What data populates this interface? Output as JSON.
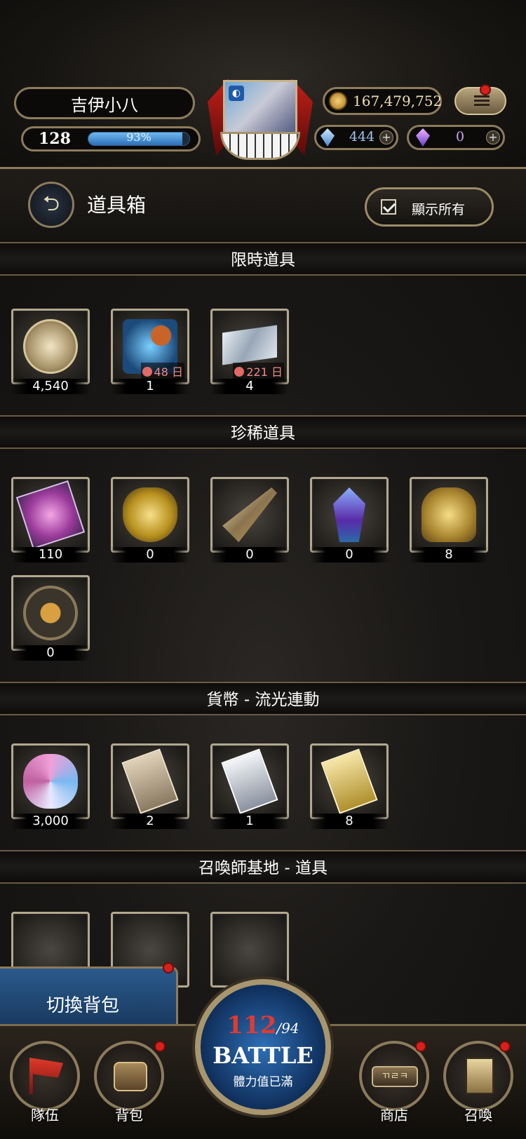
{
  "player": {
    "name": "吉伊小八",
    "level": "128",
    "exp_percent_label": "93%",
    "exp_fraction": 0.93,
    "gold": "167,479,752",
    "blue_crystals": "444",
    "purple_crystals": "0"
  },
  "header": {
    "title": "道具箱",
    "show_all_label": "顯示所有",
    "back_icon": "back-arrow-icon"
  },
  "sections": [
    {
      "title": "限時道具",
      "items": [
        {
          "name": "coin-medal",
          "count": "4,540",
          "timer": ""
        },
        {
          "name": "summon-ticket",
          "count": "1",
          "timer": "48 日"
        },
        {
          "name": "silver-ticket",
          "count": "4",
          "timer": "221 日"
        }
      ]
    },
    {
      "title": "珍稀道具",
      "items": [
        {
          "name": "pink-scroll",
          "count": "110"
        },
        {
          "name": "golden-heart",
          "count": "0"
        },
        {
          "name": "golden-horn",
          "count": "0"
        },
        {
          "name": "blue-crystal",
          "count": "0"
        },
        {
          "name": "leaf-sack",
          "count": "8"
        },
        {
          "name": "astrolabe",
          "count": "0"
        }
      ]
    },
    {
      "title": "貨幣 - 流光連動",
      "items": [
        {
          "name": "prism-gem",
          "count": "3,000"
        },
        {
          "name": "bronze-card",
          "count": "2"
        },
        {
          "name": "silver-card",
          "count": "1"
        },
        {
          "name": "gold-card",
          "count": "8"
        }
      ]
    },
    {
      "title": "召喚師基地 - 道具",
      "items": []
    }
  ],
  "switch_bag_label": "切換背包",
  "nav": {
    "team": "隊伍",
    "bag": "背包",
    "shop": "商店",
    "summon": "召喚",
    "shop_sign": "ㄲㄹㅋ"
  },
  "battle": {
    "stamina_current": "112",
    "stamina_max": "/94",
    "title": "BATTLE",
    "status": "體力值已滿"
  },
  "colors": {
    "accent_gold": "#8c7b5c",
    "battle_blue": "#2e6fb6",
    "stamina_red": "#e23a30",
    "timer_pink": "#ef8a86",
    "notify_red": "#d8201c"
  }
}
